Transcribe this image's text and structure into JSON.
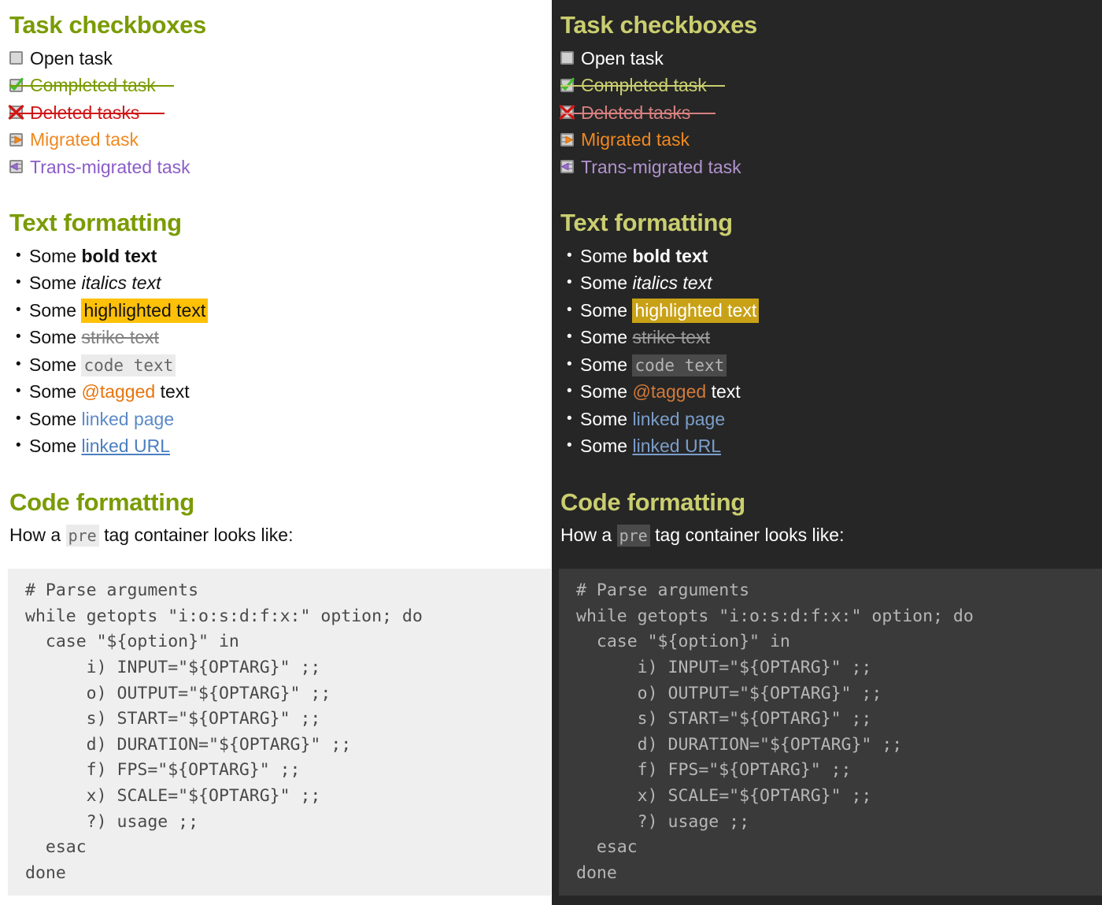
{
  "theme_colors": {
    "light_bg": "#ffffff",
    "dark_bg": "#262626",
    "light_heading": "#7a9b02",
    "dark_heading": "#cace6f",
    "light_code_bg": "#efefef",
    "dark_code_bg": "#3a3a3a",
    "light_highlight": "#ffc107",
    "dark_highlight": "#c8a116",
    "accent_orange": "#f0881f",
    "accent_purple": "#8b5cc7",
    "accent_red": "#cf1616",
    "accent_link": "#5b8ac7"
  },
  "sections": {
    "tasks_heading": "Task checkboxes",
    "text_heading": "Text formatting",
    "code_heading": "Code formatting"
  },
  "tasks": [
    {
      "icon": "checkbox-empty-icon",
      "label": "Open task",
      "state": "open"
    },
    {
      "icon": "checkbox-checked-icon",
      "label": "Completed task",
      "state": "completed"
    },
    {
      "icon": "checkbox-crossed-icon",
      "label": "Deleted tasks",
      "state": "deleted"
    },
    {
      "icon": "checkbox-arrow-right-icon",
      "label": "Migrated task",
      "state": "migrated"
    },
    {
      "icon": "checkbox-arrow-left-icon",
      "label": "Trans-migrated task",
      "state": "trans-migrated"
    }
  ],
  "formatting": {
    "prefix": "Some ",
    "items": [
      {
        "kind": "bold",
        "text": "bold text",
        "suffix": ""
      },
      {
        "kind": "italic",
        "text": "italics text",
        "suffix": ""
      },
      {
        "kind": "highlight",
        "text": "highlighted text",
        "suffix": ""
      },
      {
        "kind": "strike",
        "text": "strike text",
        "suffix": ""
      },
      {
        "kind": "code",
        "text": "code text",
        "suffix": ""
      },
      {
        "kind": "tag",
        "text": "@tagged",
        "suffix": " text"
      },
      {
        "kind": "linked-page",
        "text": "linked page",
        "suffix": ""
      },
      {
        "kind": "linked-url",
        "text": "linked URL",
        "suffix": ""
      }
    ]
  },
  "code": {
    "lede_before": "How a ",
    "lede_inline": "pre",
    "lede_after": " tag container looks like:",
    "block": "# Parse arguments\nwhile getopts \"i:o:s:d:f:x:\" option; do\n  case \"${option}\" in\n      i) INPUT=\"${OPTARG}\" ;;\n      o) OUTPUT=\"${OPTARG}\" ;;\n      s) START=\"${OPTARG}\" ;;\n      d) DURATION=\"${OPTARG}\" ;;\n      f) FPS=\"${OPTARG}\" ;;\n      x) SCALE=\"${OPTARG}\" ;;\n      ?) usage ;;\n  esac\ndone"
  }
}
